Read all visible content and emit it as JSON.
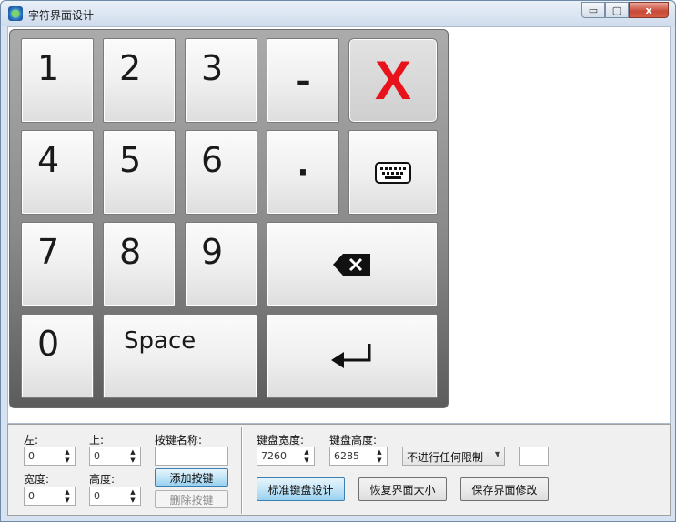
{
  "window": {
    "title": "字符界面设计",
    "minimize": "▭",
    "maximize": "▢",
    "close": "x"
  },
  "keys": {
    "k1": "1",
    "k2": "2",
    "k3": "3",
    "minus": "–",
    "close_x": "X",
    "k4": "4",
    "k5": "5",
    "k6": "6",
    "dot": "·",
    "k7": "7",
    "k8": "8",
    "k9": "9",
    "k0": "0",
    "space": "Space"
  },
  "panel": {
    "left_label": "左:",
    "left_value": "0",
    "top_label": "上:",
    "top_value": "0",
    "keyname_label": "按键名称:",
    "keyname_value": "",
    "width_label": "宽度:",
    "width_value": "0",
    "height_label": "高度:",
    "height_value": "0",
    "add_key": "添加按键",
    "delete_key": "删除按键",
    "kb_width_label": "键盘宽度:",
    "kb_width_value": "7260",
    "kb_height_label": "键盘高度:",
    "kb_height_value": "6285",
    "limit_option": "不进行任何限制",
    "extra_value": "",
    "standard_design": "标准键盘设计",
    "restore_size": "恢复界面大小",
    "save_changes": "保存界面修改"
  },
  "colors": {
    "close_key_x": "#e8121b",
    "keyboard_frame": "#8a8a8a",
    "primary_button": "#c4e5f6"
  }
}
